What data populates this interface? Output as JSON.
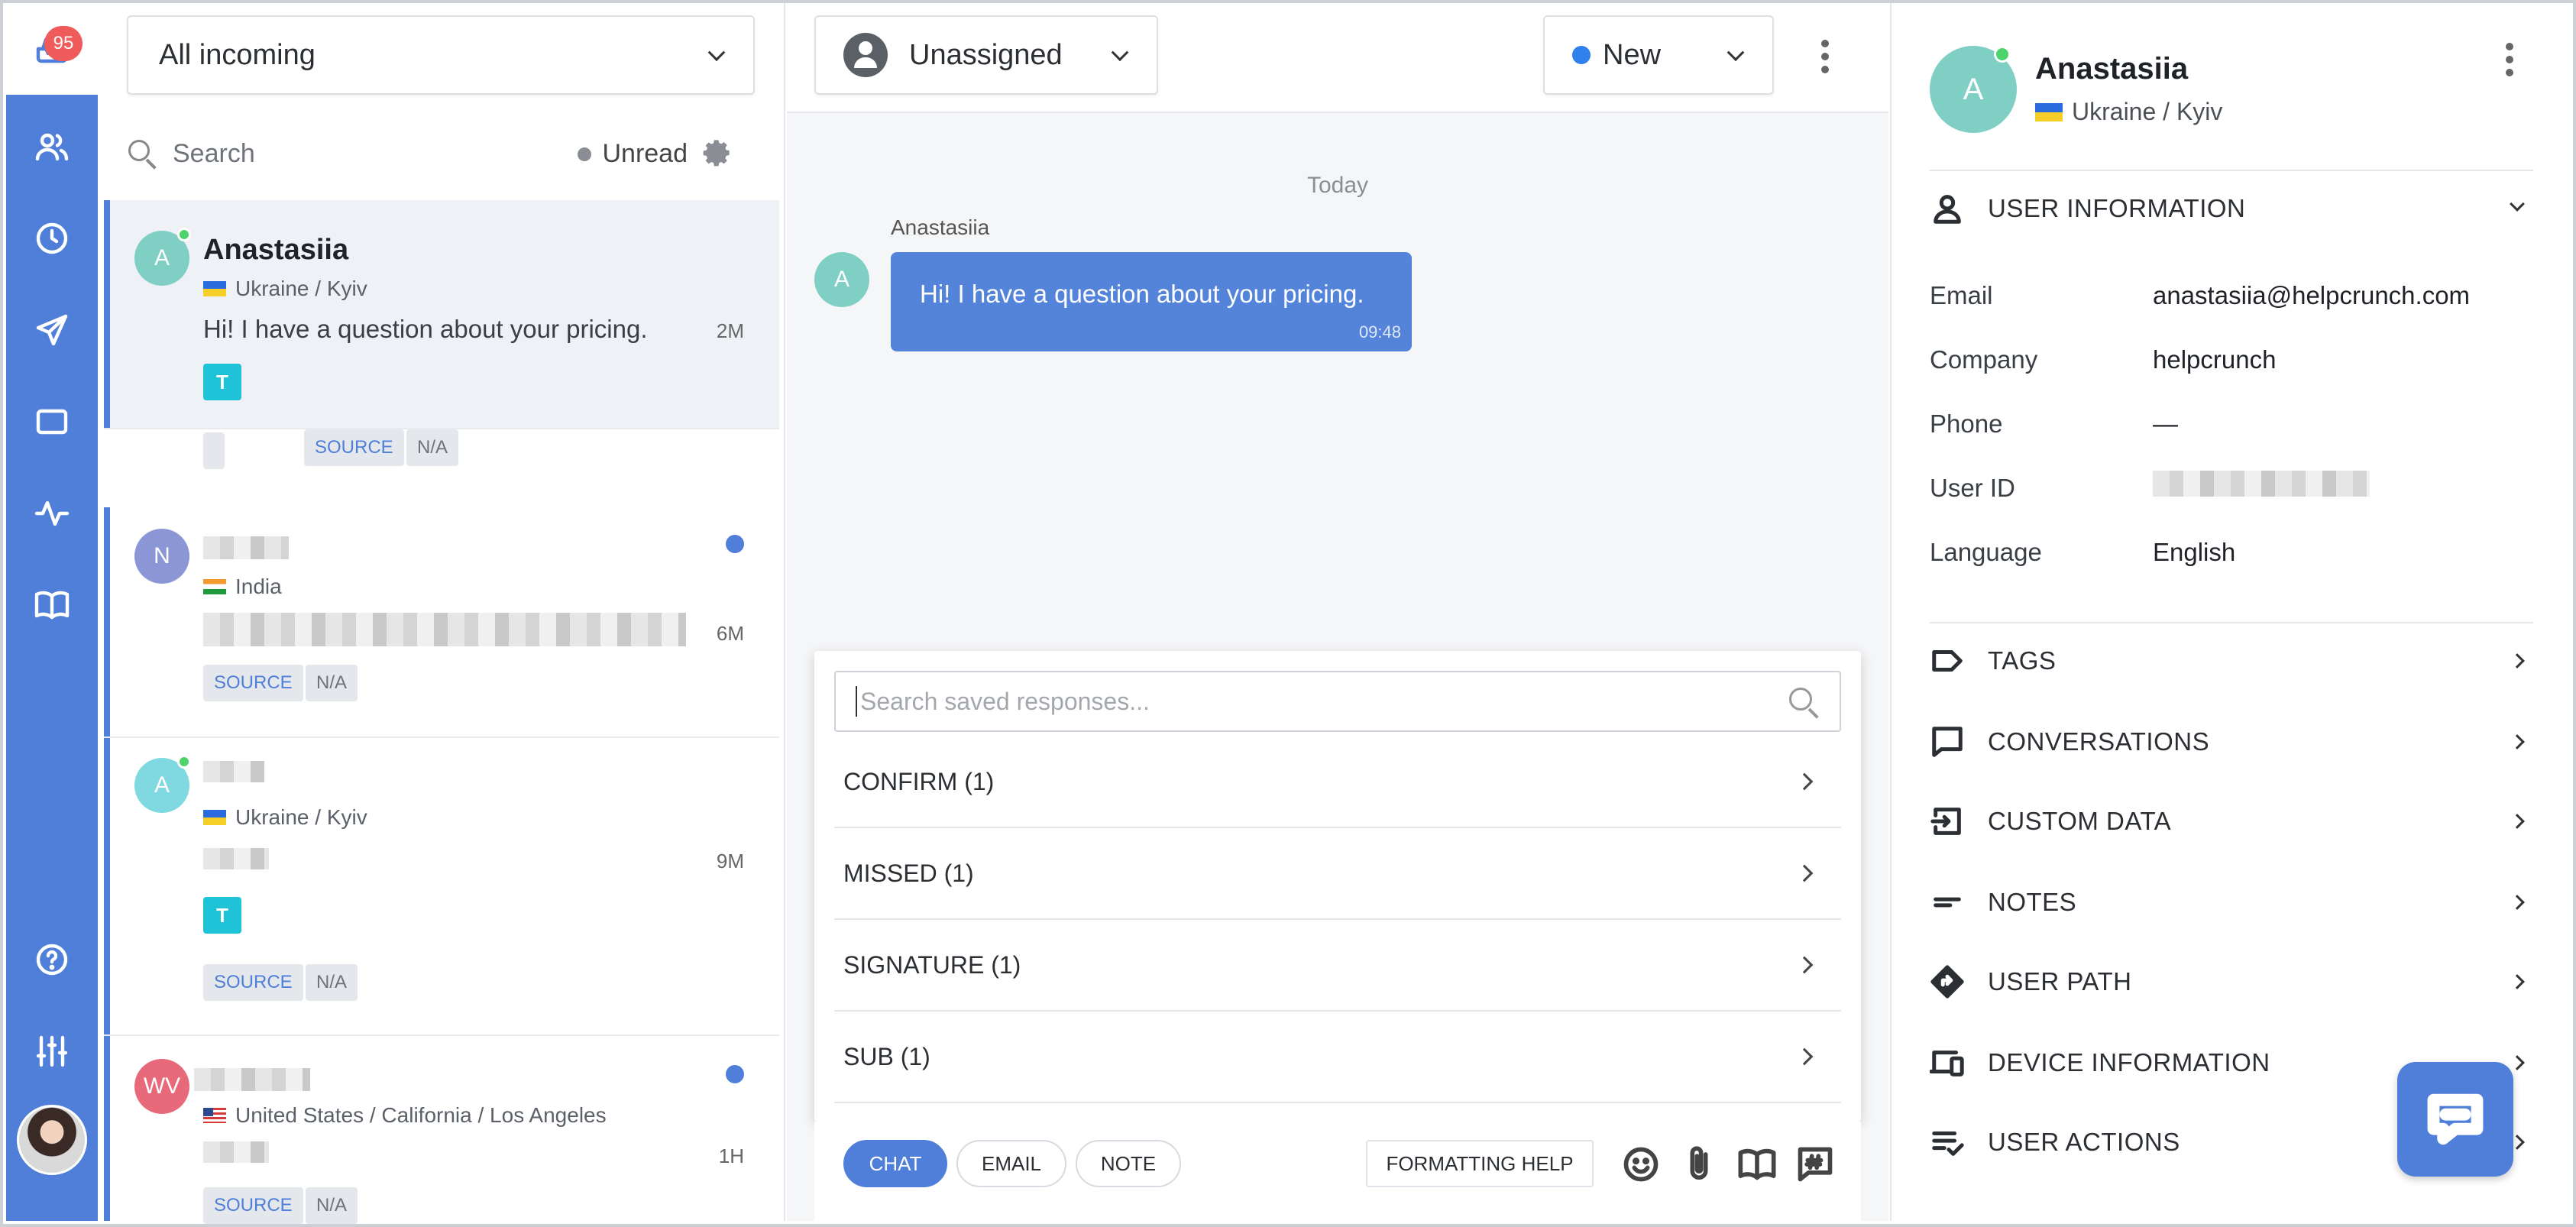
{
  "rail": {
    "inbox_badge": "95",
    "items": [
      {
        "icon": "inbox-icon"
      },
      {
        "icon": "users-icon"
      },
      {
        "icon": "clock-icon"
      },
      {
        "icon": "send-icon"
      },
      {
        "icon": "window-icon"
      },
      {
        "icon": "activity-icon"
      },
      {
        "icon": "book-icon"
      },
      {
        "icon": "help-icon"
      },
      {
        "icon": "sliders-icon"
      }
    ]
  },
  "list": {
    "inbox_selector": "All incoming",
    "search_placeholder": "Search",
    "unread_label": "Unread",
    "conversations": [
      {
        "avatar": "A",
        "name": "Anastasiia",
        "location": "Ukraine / Kyiv",
        "message": "Hi! I have a question about your pricing.",
        "time": "2M",
        "tag": "T",
        "chips": [
          "SOURCE",
          "N/A"
        ]
      },
      {
        "avatar": "N",
        "name": "",
        "location": "India",
        "message": "",
        "time": "6M",
        "tag": "",
        "chips": [
          "SOURCE",
          "N/A"
        ]
      },
      {
        "avatar": "A",
        "name": "",
        "location": "Ukraine / Kyiv",
        "message": "",
        "time": "9M",
        "tag": "T",
        "chips": [
          "SOURCE",
          "N/A"
        ]
      },
      {
        "avatar": "WV",
        "name": "",
        "location": "United States / California / Los Angeles",
        "message": "",
        "time": "1H",
        "tag": "",
        "chips": [
          "SOURCE",
          "N/A"
        ]
      }
    ]
  },
  "chat": {
    "assignee": "Unassigned",
    "status": "New",
    "day_label": "Today",
    "message": {
      "sender": "Anastasiia",
      "avatar": "A",
      "text": "Hi! I have a question about your pricing.",
      "time": "09:48"
    },
    "saved_responses": {
      "placeholder": "Search saved responses...",
      "items": [
        "CONFIRM (1)",
        "MISSED (1)",
        "SIGNATURE (1)",
        "SUB (1)"
      ]
    },
    "composer": {
      "modes": [
        "CHAT",
        "EMAIL",
        "NOTE"
      ],
      "active_mode": "CHAT",
      "formatting_help": "FORMATTING HELP"
    }
  },
  "info": {
    "avatar": "A",
    "name": "Anastasiia",
    "location": "Ukraine / Kyiv",
    "user_info_title": "USER INFORMATION",
    "fields": [
      {
        "label": "Email",
        "value": "anastasiia@helpcrunch.com"
      },
      {
        "label": "Company",
        "value": "helpcrunch"
      },
      {
        "label": "Phone",
        "value": "—"
      },
      {
        "label": "User ID",
        "value": ""
      },
      {
        "label": "Language",
        "value": "English"
      }
    ],
    "sections": [
      "TAGS",
      "CONVERSATIONS",
      "CUSTOM DATA",
      "NOTES",
      "USER PATH",
      "DEVICE INFORMATION",
      "USER ACTIONS"
    ]
  },
  "colors": {
    "brand": "#4f7fd8",
    "badge": "#ef5b5b",
    "online": "#4cd36a",
    "tag_t": "#1ec3d8",
    "status_new": "#2f80ed"
  }
}
